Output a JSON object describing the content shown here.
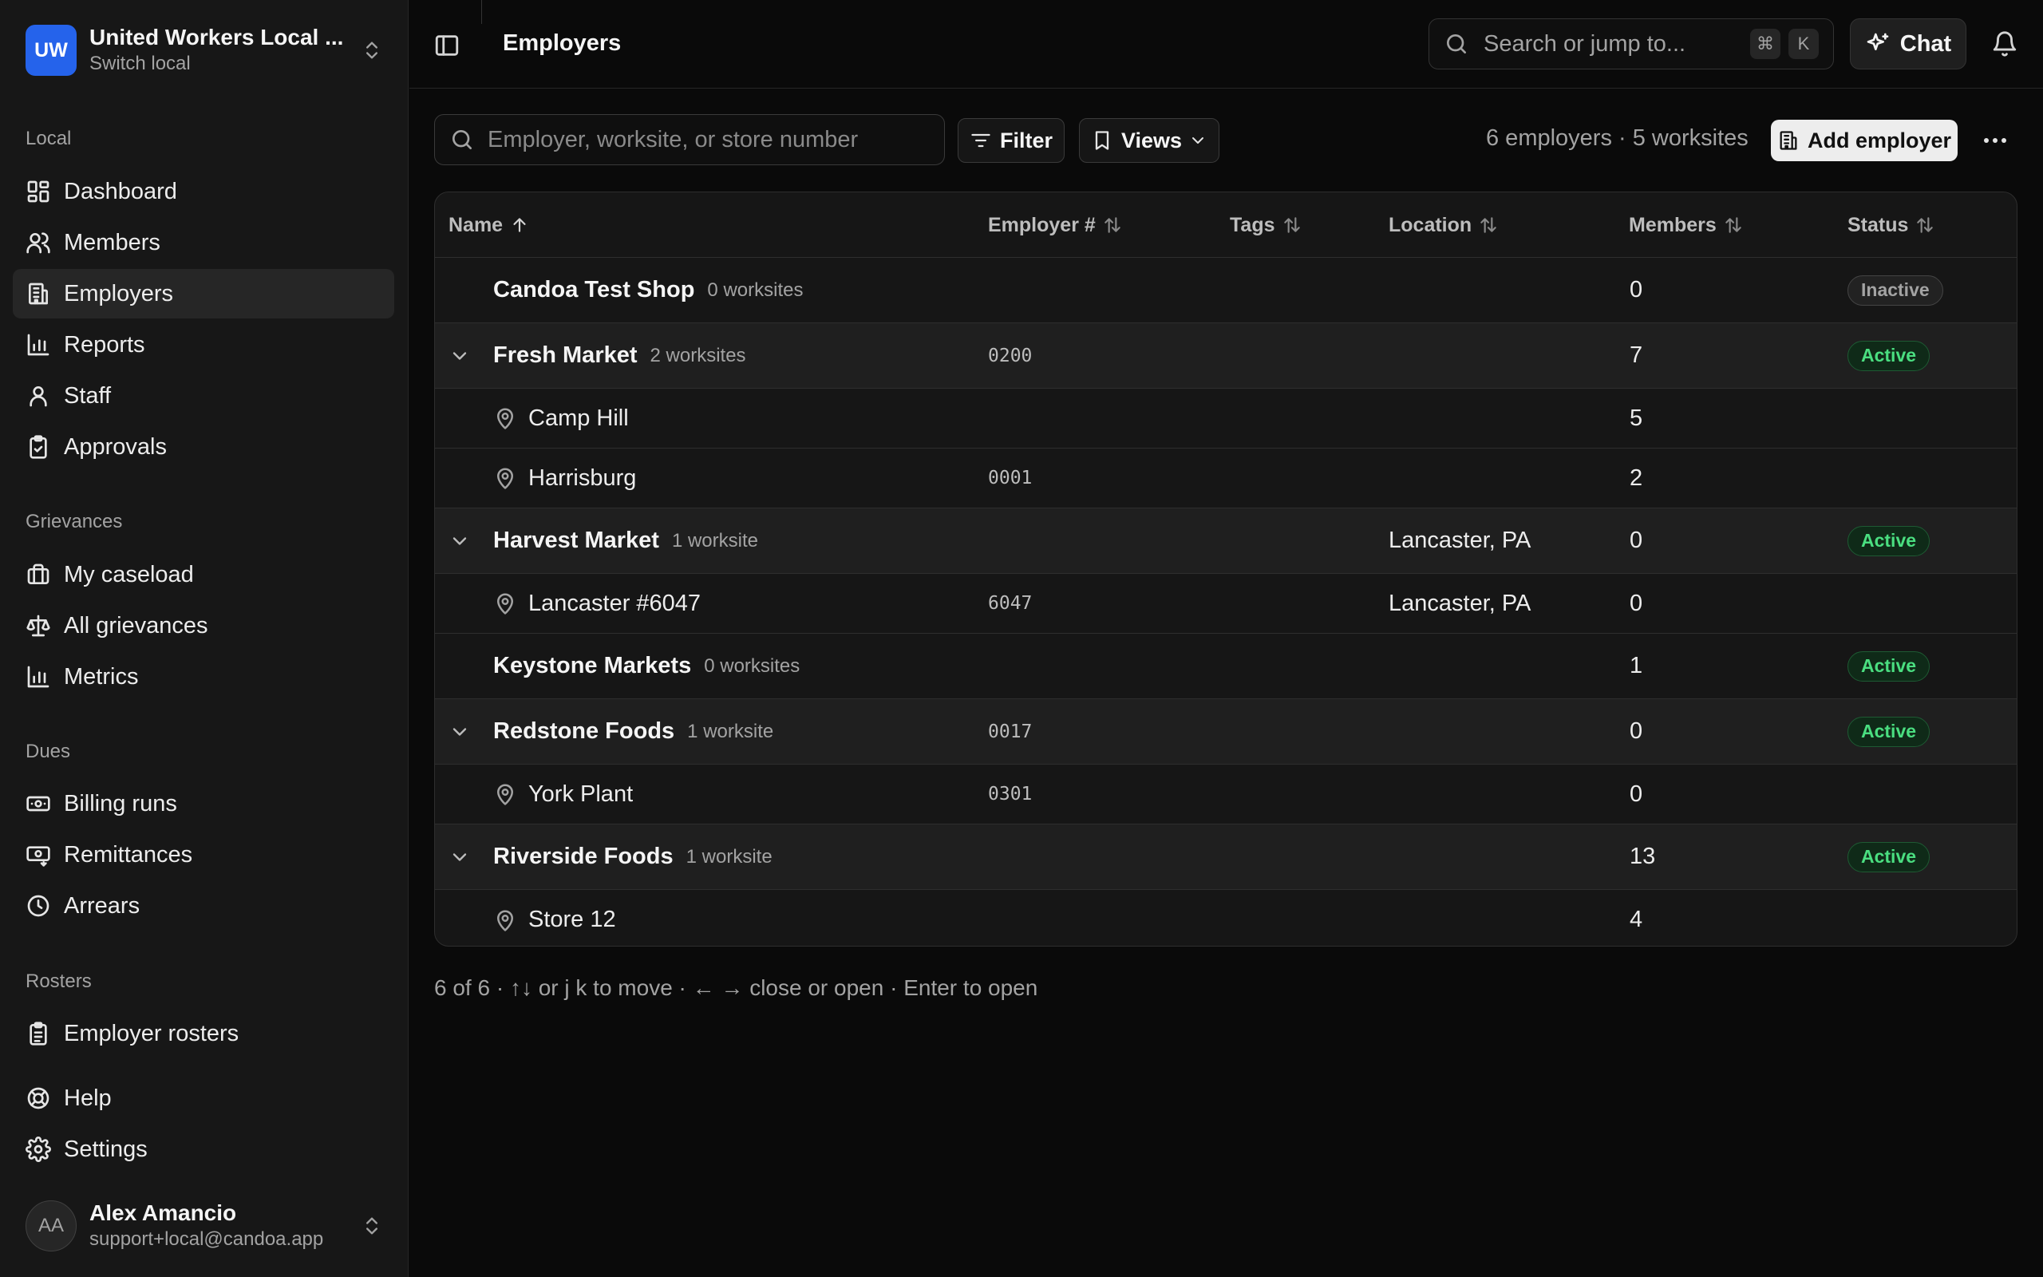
{
  "org": {
    "initials": "UW",
    "name": "United Workers Local ...",
    "subtitle": "Switch local"
  },
  "nav": {
    "local_label": "Local",
    "local": [
      {
        "label": "Dashboard",
        "icon": "dashboard-icon"
      },
      {
        "label": "Members",
        "icon": "users-icon"
      },
      {
        "label": "Employers",
        "icon": "building-icon",
        "active": true
      },
      {
        "label": "Reports",
        "icon": "bar-chart-icon"
      },
      {
        "label": "Staff",
        "icon": "user-icon"
      },
      {
        "label": "Approvals",
        "icon": "clipboard-check-icon"
      }
    ],
    "grievances_label": "Grievances",
    "grievances": [
      {
        "label": "My caseload",
        "icon": "briefcase-icon"
      },
      {
        "label": "All grievances",
        "icon": "scale-icon"
      },
      {
        "label": "Metrics",
        "icon": "bar-chart-icon"
      }
    ],
    "dues_label": "Dues",
    "dues": [
      {
        "label": "Billing runs",
        "icon": "banknote-icon"
      },
      {
        "label": "Remittances",
        "icon": "banknote-arrow-icon"
      },
      {
        "label": "Arrears",
        "icon": "clock-icon"
      }
    ],
    "rosters_label": "Rosters",
    "rosters": [
      {
        "label": "Employer rosters",
        "icon": "clipboard-list-icon"
      }
    ],
    "bottom": [
      {
        "label": "Help",
        "icon": "life-buoy-icon"
      },
      {
        "label": "Settings",
        "icon": "gear-icon"
      }
    ]
  },
  "user": {
    "initials": "AA",
    "name": "Alex Amancio",
    "email": "support+local@candoa.app"
  },
  "topbar": {
    "title": "Employers",
    "search_placeholder": "Search or jump to...",
    "kbd_cmd": "⌘",
    "kbd_k": "K",
    "chat_label": "Chat"
  },
  "toolbar": {
    "search_placeholder": "Employer, worksite, or store number",
    "filter_label": "Filter",
    "views_label": "Views",
    "counts": "6 employers · 5 worksites",
    "add_label": "Add employer"
  },
  "table": {
    "columns": [
      "Name",
      "Employer #",
      "Tags",
      "Location",
      "Members",
      "Status"
    ],
    "rows": [
      {
        "type": "employer",
        "name": "Candoa Test Shop",
        "sites": "0 worksites",
        "expandable": false,
        "number": "",
        "location": "",
        "members": "0",
        "status": "Inactive"
      },
      {
        "type": "employer",
        "name": "Fresh Market",
        "sites": "2 worksites",
        "expandable": true,
        "number": "0200",
        "location": "",
        "members": "7",
        "status": "Active"
      },
      {
        "type": "site",
        "name": "Camp Hill",
        "number": "",
        "location": "",
        "members": "5"
      },
      {
        "type": "site",
        "name": "Harrisburg",
        "number": "0001",
        "location": "",
        "members": "2"
      },
      {
        "type": "employer",
        "name": "Harvest Market",
        "sites": "1 worksite",
        "expandable": true,
        "number": "",
        "location": "Lancaster, PA",
        "members": "0",
        "status": "Active"
      },
      {
        "type": "site",
        "name": "Lancaster #6047",
        "number": "6047",
        "location": "Lancaster, PA",
        "members": "0"
      },
      {
        "type": "employer",
        "name": "Keystone Markets",
        "sites": "0 worksites",
        "expandable": false,
        "number": "",
        "location": "",
        "members": "1",
        "status": "Active"
      },
      {
        "type": "employer",
        "name": "Redstone Foods",
        "sites": "1 worksite",
        "expandable": true,
        "number": "0017",
        "location": "",
        "members": "0",
        "status": "Active"
      },
      {
        "type": "site",
        "name": "York Plant",
        "number": "0301",
        "location": "",
        "members": "0"
      },
      {
        "type": "employer",
        "name": "Riverside Foods",
        "sites": "1 worksite",
        "expandable": true,
        "number": "",
        "location": "",
        "members": "13",
        "status": "Active"
      },
      {
        "type": "site",
        "name": "Store 12",
        "number": "",
        "location": "",
        "members": "4"
      }
    ]
  },
  "footer_hint": "6 of 6 · ↑↓ or j k to move · ← → close or open · Enter to open"
}
